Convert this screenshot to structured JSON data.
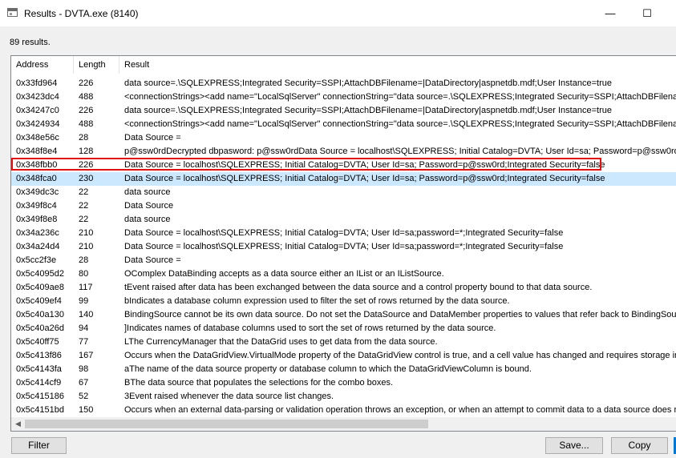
{
  "window": {
    "title": "Results - DVTA.exe (8140)",
    "minimize_glyph": "—",
    "maximize_glyph": "☐",
    "close_glyph": "✕"
  },
  "summary": {
    "count_text": "89 results."
  },
  "table": {
    "columns": [
      "Address",
      "Length",
      "Result"
    ],
    "selected_index": 7,
    "rows": [
      {
        "address": "0x33fd964",
        "length": "226",
        "result": "data source=.\\SQLEXPRESS;Integrated Security=SSPI;AttachDBFilename=|DataDirectory|aspnetdb.mdf;User Instance=true"
      },
      {
        "address": "0x3423dc4",
        "length": "488",
        "result": "<connectionStrings><add name=\"LocalSqlServer\" connectionString=\"data source=.\\SQLEXPRESS;Integrated Security=SSPI;AttachDBFilename=|DataDirectory|aspnetdb.mdf;User Instance=true\" providerName=\"System.Data.SqlClient\"/></connectionStrings>"
      },
      {
        "address": "0x34247c0",
        "length": "226",
        "result": "data source=.\\SQLEXPRESS;Integrated Security=SSPI;AttachDBFilename=|DataDirectory|aspnetdb.mdf;User Instance=true"
      },
      {
        "address": "0x3424934",
        "length": "488",
        "result": "<connectionStrings><add name=\"LocalSqlServer\" connectionString=\"data source=.\\SQLEXPRESS;Integrated Security=SSPI;AttachDBFilename=|DataDirectory|aspnetdb.mdf;User Instance=true\" providerName=\"System.Data.SqlClient\"/></connectionStrings>"
      },
      {
        "address": "0x348e56c",
        "length": "28",
        "result": "Data Source ="
      },
      {
        "address": "0x348f8e4",
        "length": "128",
        "result": "p@ssw0rdDecrypted dbpasword: p@ssw0rdData Source = localhost\\SQLEXPRESS; Initial Catalog=DVTA; User Id=sa; Password=p@ssw0rd"
      },
      {
        "address": "0x348fbb0",
        "length": "226",
        "result": "Data Source = localhost\\SQLEXPRESS; Initial Catalog=DVTA; User Id=sa; Password=p@ssw0rd;Integrated Security=false"
      },
      {
        "address": "0x348fca0",
        "length": "230",
        "result": "Data Source = localhost\\SQLEXPRESS; Initial Catalog=DVTA; User Id=sa; Password=p@ssw0rd;Integrated Security=false"
      },
      {
        "address": "0x349dc3c",
        "length": "22",
        "result": "data source"
      },
      {
        "address": "0x349f8c4",
        "length": "22",
        "result": "Data Source"
      },
      {
        "address": "0x349f8e8",
        "length": "22",
        "result": "data source"
      },
      {
        "address": "0x34a236c",
        "length": "210",
        "result": "Data Source = localhost\\SQLEXPRESS; Initial Catalog=DVTA; User Id=sa;password=*;Integrated Security=false"
      },
      {
        "address": "0x34a24d4",
        "length": "210",
        "result": "Data Source = localhost\\SQLEXPRESS; Initial Catalog=DVTA; User Id=sa;password=*;Integrated Security=false"
      },
      {
        "address": "0x5cc2f3e",
        "length": "28",
        "result": "Data Source ="
      },
      {
        "address": "0x5c4095d2",
        "length": "80",
        "result": "OComplex DataBinding accepts as a data source either an IList or an IListSource."
      },
      {
        "address": "0x5c409ae8",
        "length": "117",
        "result": "tEvent raised after data has been exchanged between the data source and a control property bound to that data source."
      },
      {
        "address": "0x5c409ef4",
        "length": "99",
        "result": "bIndicates a database column expression used to filter the set of rows returned by the data source."
      },
      {
        "address": "0x5c40a130",
        "length": "140",
        "result": "BindingSource cannot be its own data source. Do not set the DataSource and DataMember properties to values that refer back to BindingSource."
      },
      {
        "address": "0x5c40a26d",
        "length": "94",
        "result": "]Indicates names of database columns used to sort the set of rows returned by the data source."
      },
      {
        "address": "0x5c40ff75",
        "length": "77",
        "result": "LThe CurrencyManager that the DataGrid uses to get data from the data source."
      },
      {
        "address": "0x5c413f86",
        "length": "167",
        "result": "Occurs when the DataGridView.VirtualMode property of the DataGridView control is true, and a cell value has changed and requires storage in the underlying data source."
      },
      {
        "address": "0x5c4143fa",
        "length": "98",
        "result": "aThe name of the data source property or database column to which the DataGridViewColumn is bound."
      },
      {
        "address": "0x5c414cf9",
        "length": "67",
        "result": "BThe data source that populates the selections for the combo boxes."
      },
      {
        "address": "0x5c415186",
        "length": "52",
        "result": "3Event raised whenever the data source list changes."
      },
      {
        "address": "0x5c4151bd",
        "length": "150",
        "result": "Occurs when an external data-parsing or validation operation throws an exception, or when an attempt to commit data to a data source does not succeed."
      }
    ]
  },
  "buttons": {
    "filter": "Filter",
    "save": "Save...",
    "copy": "Copy"
  },
  "scroll": {
    "left_arrow": "◀"
  },
  "colors": {
    "selected_row": "#cce8ff",
    "highlight_border": "#e01010",
    "accent": "#0078d7"
  }
}
